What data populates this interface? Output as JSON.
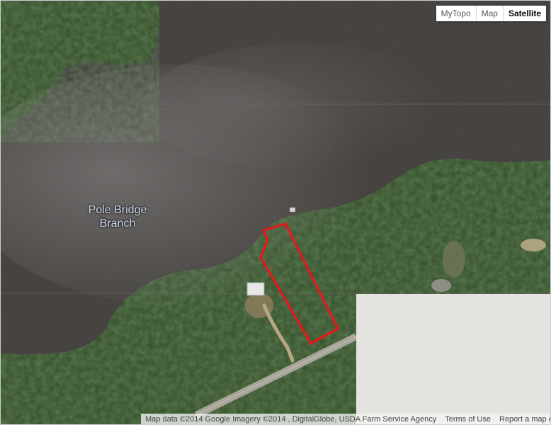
{
  "map_type_control": {
    "buttons": [
      {
        "label": "MyTopo",
        "active": false
      },
      {
        "label": "Map",
        "active": false
      },
      {
        "label": "Satellite",
        "active": true
      }
    ]
  },
  "place_label": {
    "line1": "Pole Bridge",
    "line2": "Branch"
  },
  "footer": {
    "attribution": "Map data ©2014 Google Imagery ©2014 , DigitalGlobe, USDA Farm Service Agency",
    "terms": "Terms of Use",
    "report": "Report a map error"
  },
  "colors": {
    "water": "#3b3836",
    "forest": "#2e4a23",
    "parcel_outline": "#e01b1b",
    "road": "#a9a49a",
    "unloaded_tile": "#e5e3df"
  }
}
